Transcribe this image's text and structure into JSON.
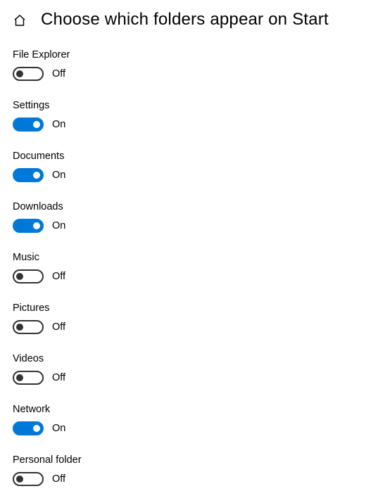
{
  "header": {
    "title": "Choose which folders appear on Start"
  },
  "labels": {
    "on": "On",
    "off": "Off"
  },
  "settings": [
    {
      "id": "file-explorer",
      "label": "File Explorer",
      "state": "off"
    },
    {
      "id": "settings",
      "label": "Settings",
      "state": "on"
    },
    {
      "id": "documents",
      "label": "Documents",
      "state": "on"
    },
    {
      "id": "downloads",
      "label": "Downloads",
      "state": "on"
    },
    {
      "id": "music",
      "label": "Music",
      "state": "off"
    },
    {
      "id": "pictures",
      "label": "Pictures",
      "state": "off"
    },
    {
      "id": "videos",
      "label": "Videos",
      "state": "off"
    },
    {
      "id": "network",
      "label": "Network",
      "state": "on"
    },
    {
      "id": "personal-folder",
      "label": "Personal folder",
      "state": "off"
    }
  ]
}
